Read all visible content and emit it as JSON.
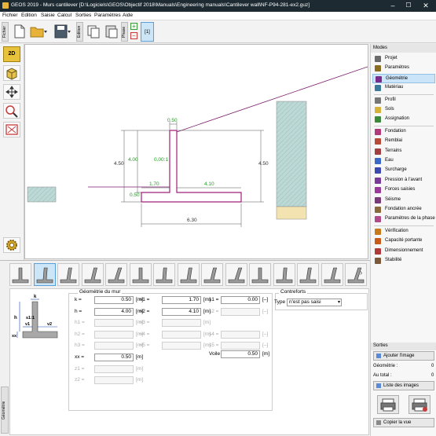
{
  "app": {
    "title": "GEOS 2019 - Murs cantilever [D:\\Logiciels\\GEOS\\Objectif 2018\\Manuals\\Engineering manuals\\Cantilever wall\\NF-P94-281-ex2.guz]"
  },
  "menu": [
    "Fichier",
    "Edition",
    "Saisie",
    "Calcul",
    "Sorties",
    "Paramètres",
    "Aide"
  ],
  "toolbar": {
    "fichier_tab": "Fichier",
    "edition_tab": "Edition",
    "phase_tab": "Phase",
    "phase_number": "[1]"
  },
  "left_toolbar": {
    "view_2d": "2D"
  },
  "drawing": {
    "dim_k": "0.50",
    "dim_h": "4.00",
    "dim_slope": "0.00:1",
    "dim_total_height": "4.50",
    "dim_right_height": "4.50",
    "dim_left_toe": "1.70",
    "dim_heel": "4.10",
    "dim_footing": "0.50",
    "dim_total_width": "6.30"
  },
  "modes": {
    "header": "Modes",
    "items": [
      {
        "label": "Projet",
        "icon": "project-icon",
        "color": "#6b6b6b"
      },
      {
        "label": "Paramètres",
        "icon": "gear-icon",
        "color": "#8a6d1f"
      },
      {
        "label": "Géométrie",
        "icon": "wall-geometry-icon",
        "color": "#7a2a8a",
        "selected": true
      },
      {
        "label": "Matériau",
        "icon": "material-icon",
        "color": "#3a7a9a"
      },
      {
        "label": "Profil",
        "icon": "profile-icon",
        "color": "#777777"
      },
      {
        "label": "Sols",
        "icon": "soils-icon",
        "color": "#d6b23a"
      },
      {
        "label": "Assignation",
        "icon": "assign-icon",
        "color": "#3a8a3a"
      },
      {
        "label": "Fondation",
        "icon": "foundation-icon",
        "color": "#b03a7a"
      },
      {
        "label": "Remblai",
        "icon": "backfill-icon",
        "color": "#b84a3a"
      },
      {
        "label": "Terrains",
        "icon": "terrain-icon",
        "color": "#a04040"
      },
      {
        "label": "Eau",
        "icon": "water-icon",
        "color": "#3a6ac8"
      },
      {
        "label": "Surcharge",
        "icon": "surcharge-icon",
        "color": "#3a4ab0"
      },
      {
        "label": "Pression à l'avant",
        "icon": "front-pressure-icon",
        "color": "#7a3a9a"
      },
      {
        "label": "Forces saisies",
        "icon": "forces-icon",
        "color": "#9a3a9a"
      },
      {
        "label": "Séisme",
        "icon": "earthquake-icon",
        "color": "#7a3a7a"
      },
      {
        "label": "Fondation ancrée",
        "icon": "anchored-foundation-icon",
        "color": "#8a6a3a"
      },
      {
        "label": "Paramètres de la phase",
        "icon": "phase-settings-icon",
        "color": "#b04a8a"
      },
      {
        "label": "Vérification",
        "icon": "verification-icon",
        "color": "#c87a1a"
      },
      {
        "label": "Capacité portante",
        "icon": "bearing-capacity-icon",
        "color": "#c85a1a"
      },
      {
        "label": "Dimensionnement",
        "icon": "dimensioning-icon",
        "color": "#b03a3a"
      },
      {
        "label": "Stabilité",
        "icon": "stability-icon",
        "color": "#7a5a3a"
      }
    ]
  },
  "sorties": {
    "header": "Sorties",
    "add_image": "Ajouter l'image",
    "geometry_label": "Géométrie :",
    "geometry_count": "0",
    "total_label": "Au total :",
    "total_count": "0",
    "image_list": "Liste des images",
    "copy_view": "Copier la vue"
  },
  "form": {
    "section_title": "Géométrie du mur",
    "contreforts_title": "Contreforts",
    "side_tab": "Géométrie",
    "type_label": "Type",
    "type_value": "n'est pas saisi",
    "voile_label": "Voile",
    "voile_value": "0.50",
    "voile_unit": "[m]",
    "col1": [
      {
        "label": "k =",
        "value": "0.50",
        "unit": "[m]",
        "enabled": true
      },
      {
        "label": "h =",
        "value": "4.00",
        "unit": "[m]",
        "enabled": true
      },
      {
        "label": "h1 =",
        "value": "",
        "unit": "[m]",
        "enabled": false
      },
      {
        "label": "h2 =",
        "value": "",
        "unit": "[m]",
        "enabled": false
      },
      {
        "label": "h3 =",
        "value": "",
        "unit": "[m]",
        "enabled": false
      },
      {
        "label": "xx =",
        "value": "0.50",
        "unit": "[m]",
        "enabled": true
      },
      {
        "label": "z1 =",
        "value": "",
        "unit": "[m]",
        "enabled": false
      },
      {
        "label": "z2 =",
        "value": "",
        "unit": "[m]",
        "enabled": false
      }
    ],
    "col2": [
      {
        "label": "v1 =",
        "value": "1.70",
        "unit": "[m]",
        "enabled": true
      },
      {
        "label": "v2 =",
        "value": "4.10",
        "unit": "[m]",
        "enabled": true
      },
      {
        "label": "v3 =",
        "value": "",
        "unit": "[m]",
        "enabled": false
      },
      {
        "label": "v4 =",
        "value": "",
        "unit": "[m]",
        "enabled": false
      },
      {
        "label": "v5 =",
        "value": "",
        "unit": "[m]",
        "enabled": false
      }
    ],
    "col3": [
      {
        "label": "s1 =",
        "value": "0.00",
        "unit": "[–]",
        "enabled": true
      },
      {
        "label": "s2 =",
        "value": "",
        "unit": "[–]",
        "enabled": false
      },
      {
        "label": "",
        "value": "",
        "unit": "",
        "enabled": false
      },
      {
        "label": "s4 =",
        "value": "",
        "unit": "[–]",
        "enabled": false
      },
      {
        "label": "s5 =",
        "value": "",
        "unit": "[–]",
        "enabled": false
      }
    ],
    "diagram": {
      "k": "k",
      "h": "h",
      "s": "s1:1",
      "v1": "v1",
      "v2": "v2",
      "xx": "xx"
    }
  },
  "colors": {
    "wall": "#a0207a",
    "soil": "#bdd9d6",
    "sand": "#f2e3b0",
    "dimension": "#20a020",
    "selection": "#cce4f7"
  }
}
